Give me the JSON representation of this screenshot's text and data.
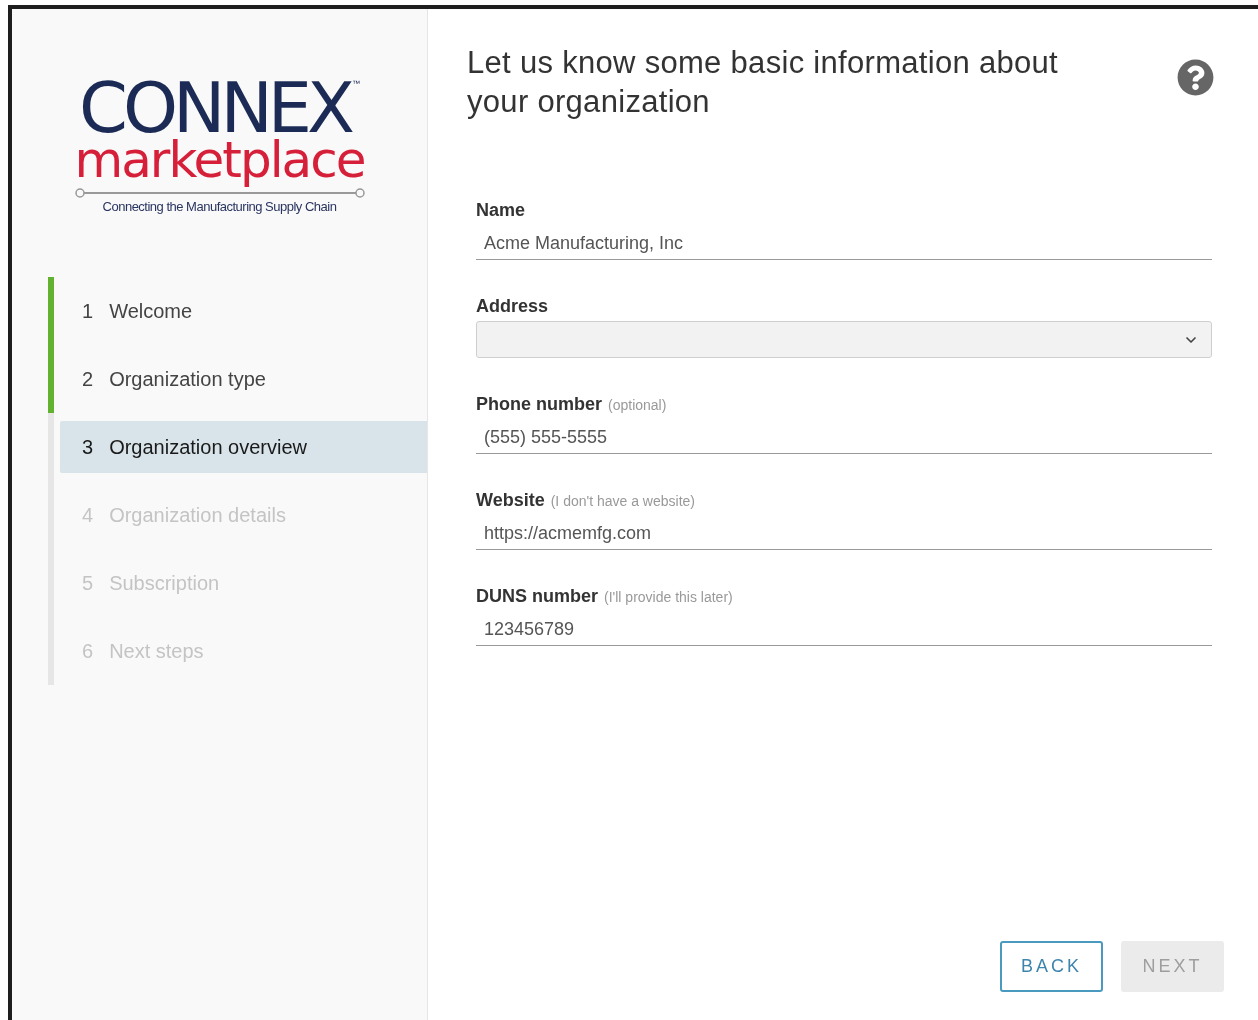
{
  "logo": {
    "wordmark": "CONNEX",
    "trademark": "™",
    "subtitle": "marketplace",
    "tagline": "Connecting the Manufacturing Supply Chain"
  },
  "steps": [
    {
      "number": "1",
      "label": "Welcome",
      "completed": true,
      "selected": false,
      "disabled": false
    },
    {
      "number": "2",
      "label": "Organization type",
      "completed": true,
      "selected": false,
      "disabled": false
    },
    {
      "number": "3",
      "label": "Organization overview",
      "completed": false,
      "selected": true,
      "disabled": false
    },
    {
      "number": "4",
      "label": "Organization details",
      "completed": false,
      "selected": false,
      "disabled": true
    },
    {
      "number": "5",
      "label": "Subscription",
      "completed": false,
      "selected": false,
      "disabled": true
    },
    {
      "number": "6",
      "label": "Next steps",
      "completed": false,
      "selected": false,
      "disabled": true
    }
  ],
  "heading": "Let us know some basic information about your organization",
  "fields": [
    {
      "kind": "text",
      "label": "Name",
      "value": "Acme Manufacturing, Inc"
    },
    {
      "kind": "select",
      "label": "Address"
    },
    {
      "kind": "text",
      "label": "Phone number",
      "note": "(optional)",
      "value": "(555) 555-5555"
    },
    {
      "kind": "text",
      "label": "Website",
      "note": "(I don't have a website)",
      "value": "https://acmemfg.com"
    },
    {
      "kind": "text",
      "label": "DUNS number",
      "note": "(I'll provide this later)",
      "value": "123456789"
    }
  ],
  "buttons": [
    {
      "label": "BACK",
      "disabled": false
    },
    {
      "label": "NEXT",
      "disabled": true
    }
  ]
}
